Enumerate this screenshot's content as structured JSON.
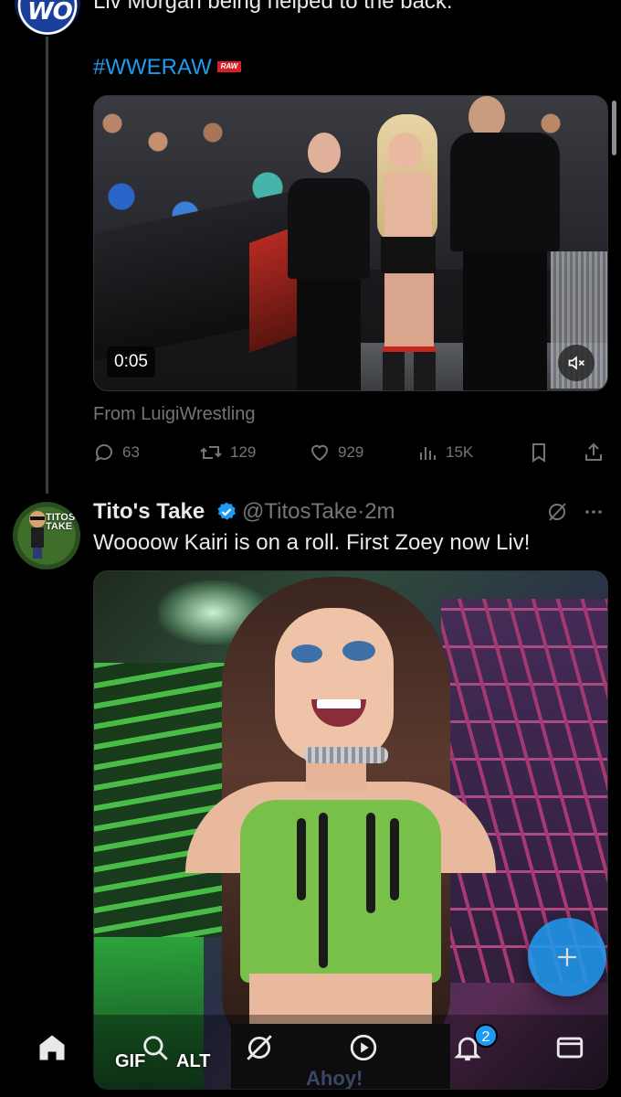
{
  "previous_tweet": {
    "avatar_text": "WO",
    "text": "Liv Morgan being helped to the back.",
    "hashtag": "#WWERAW",
    "hashtag_badge": "RAW",
    "video": {
      "duration": "0:05"
    },
    "source": "From LuigiWrestling",
    "actions": {
      "replies": "63",
      "reposts": "129",
      "likes": "929",
      "views": "15K"
    }
  },
  "tweet": {
    "avatar_text": "TITOS TAKE",
    "name": "Tito's Take",
    "handle": "@TitosTake",
    "separator": "·",
    "time": "2m",
    "text": "Woooow Kairi is on a roll. First Zoey now Liv!",
    "gif_labels": {
      "gif": "GIF",
      "alt": "ALT"
    },
    "gif_caption_text": "Ahoy!"
  },
  "bottom_nav": {
    "items": [
      "home-icon",
      "search-icon",
      "grok-icon",
      "video-icon",
      "bell-icon",
      "mail-icon"
    ],
    "notification_count": "2"
  },
  "colors": {
    "background": "#000000",
    "text": "#e7e9ea",
    "muted": "#71767b",
    "accent": "#1d9bf0"
  }
}
